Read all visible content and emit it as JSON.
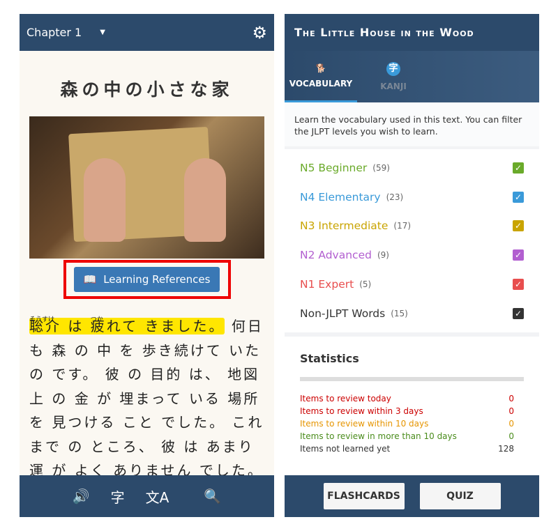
{
  "left": {
    "chapter": "Chapter 1",
    "title": "森の中の小さな家",
    "reference_button": "Learning References",
    "sentence_highlight": [
      "聡介",
      "は",
      "疲れて",
      "きました。"
    ],
    "furigana": [
      "そうすけ",
      "つか"
    ],
    "text_lines": [
      "何日",
      "も 森 の 中 を 歩き続けて いた",
      "の です。 彼 の 目的 は、 地図",
      "上 の 金 が 埋まって いる 場所",
      "を 見つける こと でした。 これ",
      "まで の ところ、 彼 は あまり",
      "運 が よく ありません でした。"
    ],
    "toolbar": {
      "audio": "🔊",
      "kanji": "字",
      "translate": "文A",
      "search": "🔍"
    }
  },
  "right": {
    "title": "The Little House in the Wood",
    "tabs": [
      {
        "label": "VOCABULARY",
        "icon": "dog-icon"
      },
      {
        "label": "KANJI",
        "icon": "kanji-icon"
      }
    ],
    "description": "Learn the vocabulary used in this text. You can filter the JLPT levels you wish to learn.",
    "levels": [
      {
        "label": "N5 Beginner",
        "count": "(59)",
        "color": "#6aaa2a",
        "checked": true
      },
      {
        "label": "N4 Elementary",
        "count": "(23)",
        "color": "#3a9ad9",
        "checked": true
      },
      {
        "label": "N3 Intermediate",
        "count": "(17)",
        "color": "#c9a400",
        "checked": true
      },
      {
        "label": "N2 Advanced",
        "count": "(9)",
        "color": "#b25fd0",
        "checked": true
      },
      {
        "label": "N1 Expert",
        "count": "(5)",
        "color": "#e84e4e",
        "checked": true
      },
      {
        "label": "Non-JLPT Words",
        "count": "(15)",
        "color": "#333333",
        "checked": true
      }
    ],
    "statistics": {
      "heading": "Statistics",
      "rows": [
        {
          "label": "Items to review today",
          "value": "0",
          "color": "#cc0000"
        },
        {
          "label": "Items to review within 3 days",
          "value": "0",
          "color": "#cc0000"
        },
        {
          "label": "Items to review within 10 days",
          "value": "0",
          "color": "#e69500"
        },
        {
          "label": "Items to review in more than 10 days",
          "value": "0",
          "color": "#4a8c1c"
        },
        {
          "label": "Items not learned yet",
          "value": "128",
          "color": "#333333"
        }
      ]
    },
    "buttons": {
      "flashcards": "FLASHCARDS",
      "quiz": "QUIZ"
    }
  }
}
